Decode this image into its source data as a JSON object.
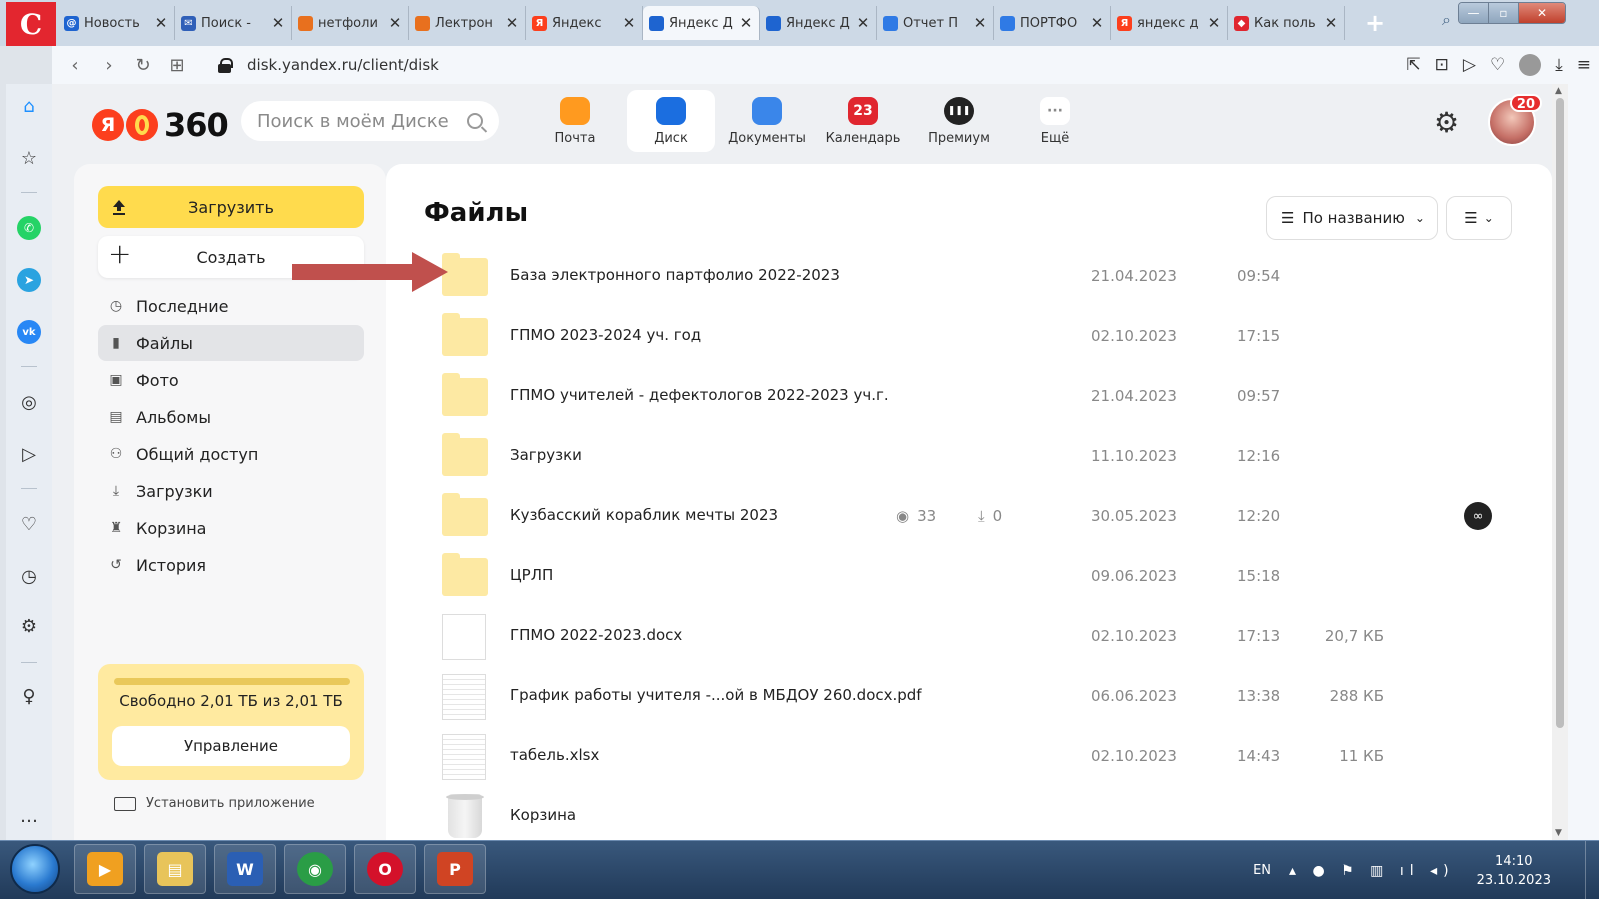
{
  "browser": {
    "tabs": [
      {
        "label": "Новость",
        "color": "#1e64d0",
        "glyph": "@"
      },
      {
        "label": "Поиск -",
        "color": "#2f5fb8",
        "glyph": "✉"
      },
      {
        "label": "нетфоли",
        "color": "#e8701e",
        "glyph": ""
      },
      {
        "label": "Лектрон",
        "color": "#e8701e",
        "glyph": ""
      },
      {
        "label": "Яндекс",
        "color": "#fc3f1d",
        "glyph": "Я"
      },
      {
        "label": "Яндекс Д",
        "color": "#1e64d0",
        "glyph": ""
      },
      {
        "label": "Яндекс Д",
        "color": "#1e64d0",
        "glyph": ""
      },
      {
        "label": "Отчет П",
        "color": "#2f7ae5",
        "glyph": ""
      },
      {
        "label": "ПОРТФО",
        "color": "#2f7ae5",
        "glyph": ""
      },
      {
        "label": "яндекс д",
        "color": "#fc3f1d",
        "glyph": "Я"
      },
      {
        "label": "Как поль",
        "color": "#e0262f",
        "glyph": "◆"
      }
    ],
    "active_tab_index": 5,
    "new_tab_label": "+",
    "url": "disk.yandex.ru/client/disk"
  },
  "app": {
    "search_placeholder": "Поиск в моём Диске",
    "logo_text": "360",
    "services": [
      {
        "label": "Почта",
        "icon": "mail-icon",
        "color": "#ff9a1f",
        "badge": ""
      },
      {
        "label": "Диск",
        "icon": "disk-icon",
        "color": "#1b6ee0",
        "badge": ""
      },
      {
        "label": "Документы",
        "icon": "documents-icon",
        "color": "#3a86ea",
        "badge": ""
      },
      {
        "label": "Календарь",
        "icon": "calendar-icon",
        "color": "#e0262f",
        "badge": "23"
      },
      {
        "label": "Премиум",
        "icon": "premium-icon",
        "color": "#222222",
        "badge": ""
      },
      {
        "label": "Ещё",
        "icon": "more-icon",
        "color": "#ffffff",
        "badge": ""
      }
    ],
    "active_service_index": 1,
    "avatar_badge": "20"
  },
  "sidebar": {
    "upload_label": "Загрузить",
    "create_label": "Создать",
    "items": [
      {
        "label": "Последние",
        "icon": "clock-icon"
      },
      {
        "label": "Файлы",
        "icon": "file-icon"
      },
      {
        "label": "Фото",
        "icon": "photo-icon"
      },
      {
        "label": "Альбомы",
        "icon": "albums-icon"
      },
      {
        "label": "Общий доступ",
        "icon": "shared-icon"
      },
      {
        "label": "Загрузки",
        "icon": "download-icon"
      },
      {
        "label": "Корзина",
        "icon": "trash-icon"
      },
      {
        "label": "История",
        "icon": "history-icon"
      }
    ],
    "active_index": 1,
    "storage_text": "Свободно 2,01 ТБ из 2,01 ТБ",
    "storage_used_fraction": 0.0,
    "manage_label": "Управление",
    "install_label": "Установить приложение"
  },
  "main": {
    "title": "Файлы",
    "sort_label": "По названию",
    "files": [
      {
        "name": "База электронного партфолио 2022-2023",
        "type": "folder",
        "date": "21.04.2023",
        "time": "09:54",
        "size": ""
      },
      {
        "name": "ГПМО 2023-2024 уч. год",
        "type": "folder",
        "date": "02.10.2023",
        "time": "17:15",
        "size": ""
      },
      {
        "name": "ГПМО учителей - дефектологов 2022-2023 уч.г.",
        "type": "folder",
        "date": "21.04.2023",
        "time": "09:57",
        "size": ""
      },
      {
        "name": "Загрузки",
        "type": "folder",
        "date": "11.10.2023",
        "time": "12:16",
        "size": ""
      },
      {
        "name": "Кузбасский кораблик мечты 2023",
        "type": "folder",
        "date": "30.05.2023",
        "time": "12:20",
        "size": "",
        "views": "33",
        "downloads": "0",
        "shared": true
      },
      {
        "name": "ЦРЛП",
        "type": "folder",
        "date": "09.06.2023",
        "time": "15:18",
        "size": ""
      },
      {
        "name": "ГПМО 2022-2023.docx",
        "type": "doc",
        "date": "02.10.2023",
        "time": "17:13",
        "size": "20,7 КБ"
      },
      {
        "name": "График работы учителя -...ой в МБДОУ 260.docx.pdf",
        "type": "pdf",
        "date": "06.06.2023",
        "time": "13:38",
        "size": "288 КБ"
      },
      {
        "name": "табель.xlsx",
        "type": "xlsx",
        "date": "02.10.2023",
        "time": "14:43",
        "size": "11 КБ"
      },
      {
        "name": "Корзина",
        "type": "trash",
        "date": "",
        "time": "",
        "size": ""
      }
    ]
  },
  "taskbar": {
    "apps": [
      {
        "name": "media-player",
        "color": "#f0a020",
        "glyph": "▶"
      },
      {
        "name": "explorer",
        "color": "#e8c45a",
        "glyph": "▤"
      },
      {
        "name": "word",
        "color": "#2b5fb4",
        "glyph": "W"
      },
      {
        "name": "chrome",
        "color": "#2a9d46",
        "glyph": "◉"
      },
      {
        "name": "opera",
        "color": "#d4112a",
        "glyph": "O"
      },
      {
        "name": "powerpoint",
        "color": "#d04423",
        "glyph": "P"
      }
    ],
    "lang": "EN",
    "time": "14:10",
    "date": "23.10.2023"
  }
}
